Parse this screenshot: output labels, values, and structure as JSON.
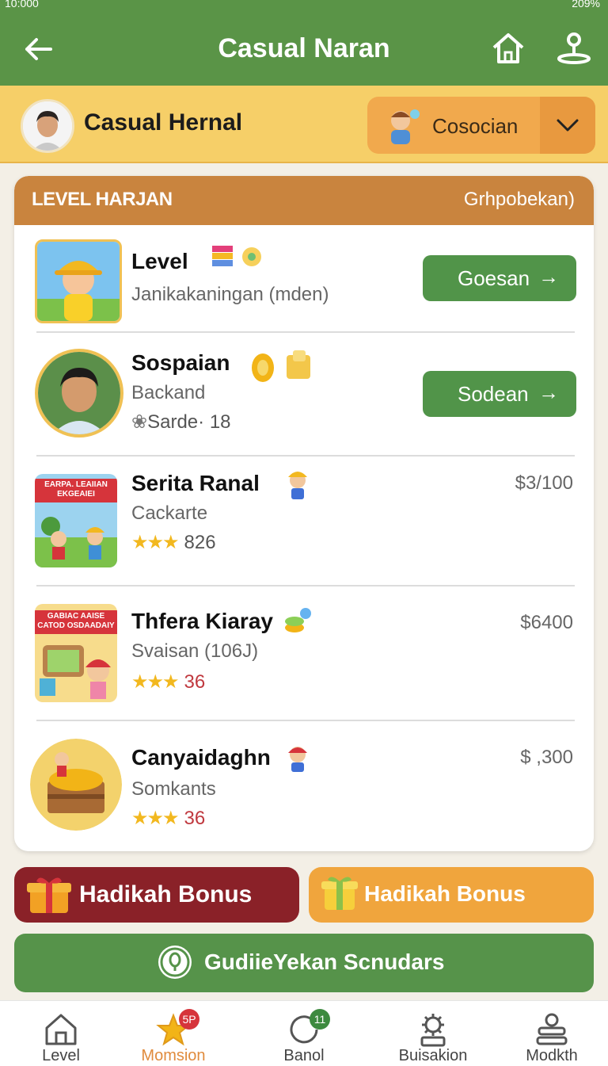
{
  "status_bar": {
    "left": "10:000",
    "right": "209%"
  },
  "header": {
    "title": "Casual Naran"
  },
  "profile": {
    "name": "Casual Hernal",
    "selector_value": "Cosocian"
  },
  "panel": {
    "title": "LEVEL HARJAN",
    "subtitle": "Grhpobekan)",
    "items": [
      {
        "title": "Level",
        "subtitle": "Janikakaningan (mden)",
        "button": "Goesan",
        "button_arrow": "→"
      },
      {
        "title": "Sospaian",
        "subtitle": "Backand",
        "meta": "Sarde· 18",
        "button": "Sodean",
        "button_arrow": "→"
      },
      {
        "title": "Serita Ranal",
        "subtitle": "Cackarte",
        "stars": "★★★",
        "rating": "826",
        "price": "$3/100",
        "thumb_banner": "EARPA. LEAIIAN EKGEAIEI"
      },
      {
        "title": "Thfera Kiaray",
        "subtitle": "Svaisan (106J)",
        "stars": "★★★",
        "rating": "36",
        "price": "$6400",
        "thumb_banner": "GABIAC AAISE CATOD OSDAADAIY"
      },
      {
        "title": "Canyaidaghn",
        "subtitle": "Somkants",
        "stars": "★★★",
        "rating": "36",
        "price": "$ ,300"
      }
    ]
  },
  "bonus": {
    "left_label": "Hadikah Bonus",
    "right_label": "Hadikah Bonus"
  },
  "cta": {
    "label": "GudiieYekan Scnudars"
  },
  "nav": {
    "items": [
      {
        "label": "Level"
      },
      {
        "label": "Momsion",
        "badge": "5P"
      },
      {
        "label": "Banol",
        "badge": "11"
      },
      {
        "label": "Buisakion"
      },
      {
        "label": "Modkth"
      }
    ]
  },
  "colors": {
    "primary_green": "#5a9447",
    "accent_orange": "#f0a53d",
    "bonus_red": "#8a2128",
    "profile_yellow": "#f6cf68"
  }
}
